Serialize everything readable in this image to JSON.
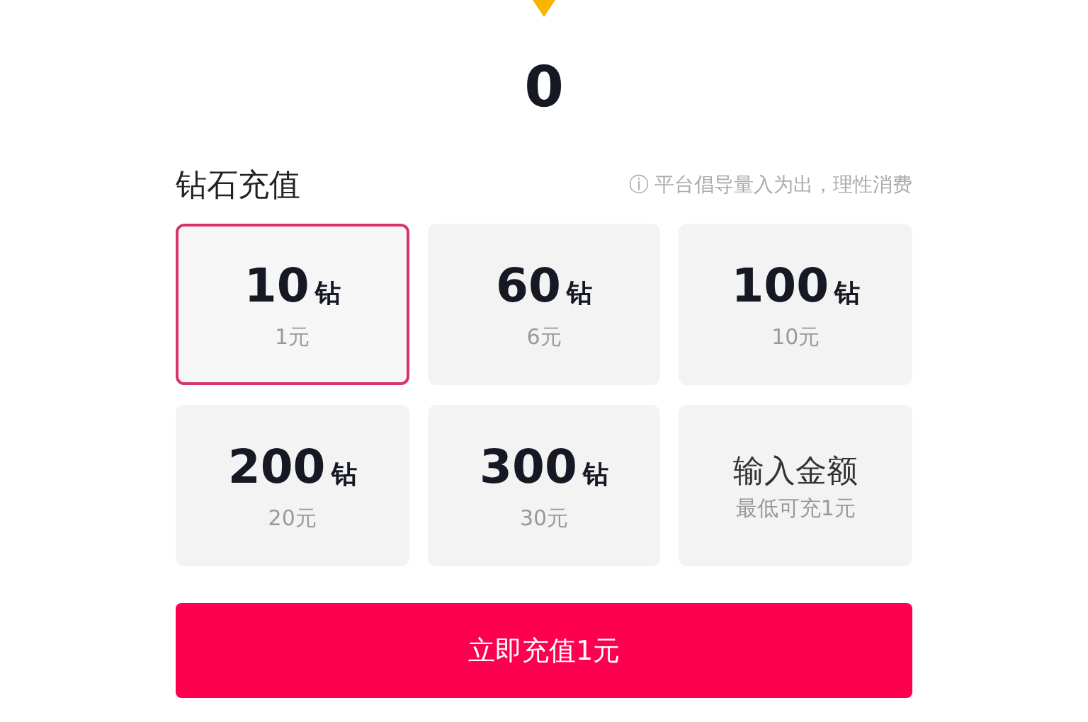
{
  "balance": "0",
  "section": {
    "title": "钻石充值",
    "notice_icon": "ⓘ",
    "notice": "平台倡导量入为出，理性消费"
  },
  "options": [
    {
      "kind": "preset",
      "amount": "10",
      "unit": "钻",
      "price": "1元",
      "selected": true
    },
    {
      "kind": "preset",
      "amount": "60",
      "unit": "钻",
      "price": "6元",
      "selected": false
    },
    {
      "kind": "preset",
      "amount": "100",
      "unit": "钻",
      "price": "10元",
      "selected": false
    },
    {
      "kind": "preset",
      "amount": "200",
      "unit": "钻",
      "price": "20元",
      "selected": false
    },
    {
      "kind": "preset",
      "amount": "300",
      "unit": "钻",
      "price": "30元",
      "selected": false
    },
    {
      "kind": "custom",
      "title": "输入金额",
      "hint": "最低可充1元",
      "selected": false
    }
  ],
  "submit": "立即充值1元"
}
